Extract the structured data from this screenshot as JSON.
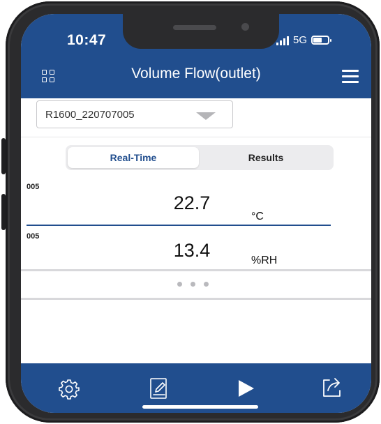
{
  "status_bar": {
    "time": "10:47",
    "network": "5G"
  },
  "header": {
    "title": "Volume Flow(outlet)"
  },
  "device_selector": {
    "value": "R1600_220707005"
  },
  "tabs": [
    {
      "label": "Real-Time",
      "active": true
    },
    {
      "label": "Results",
      "active": false
    }
  ],
  "readings": [
    {
      "id": "005",
      "value": "22.7",
      "unit": "°C"
    },
    {
      "id": "005",
      "value": "13.4",
      "unit": "%RH"
    }
  ],
  "toolbar": {
    "icons": [
      "gear-icon",
      "edit-note-icon",
      "play-icon",
      "share-icon"
    ]
  },
  "colors": {
    "primary": "#214e8e",
    "background": "#ffffff",
    "phone_frame": "#2b2b2d"
  }
}
